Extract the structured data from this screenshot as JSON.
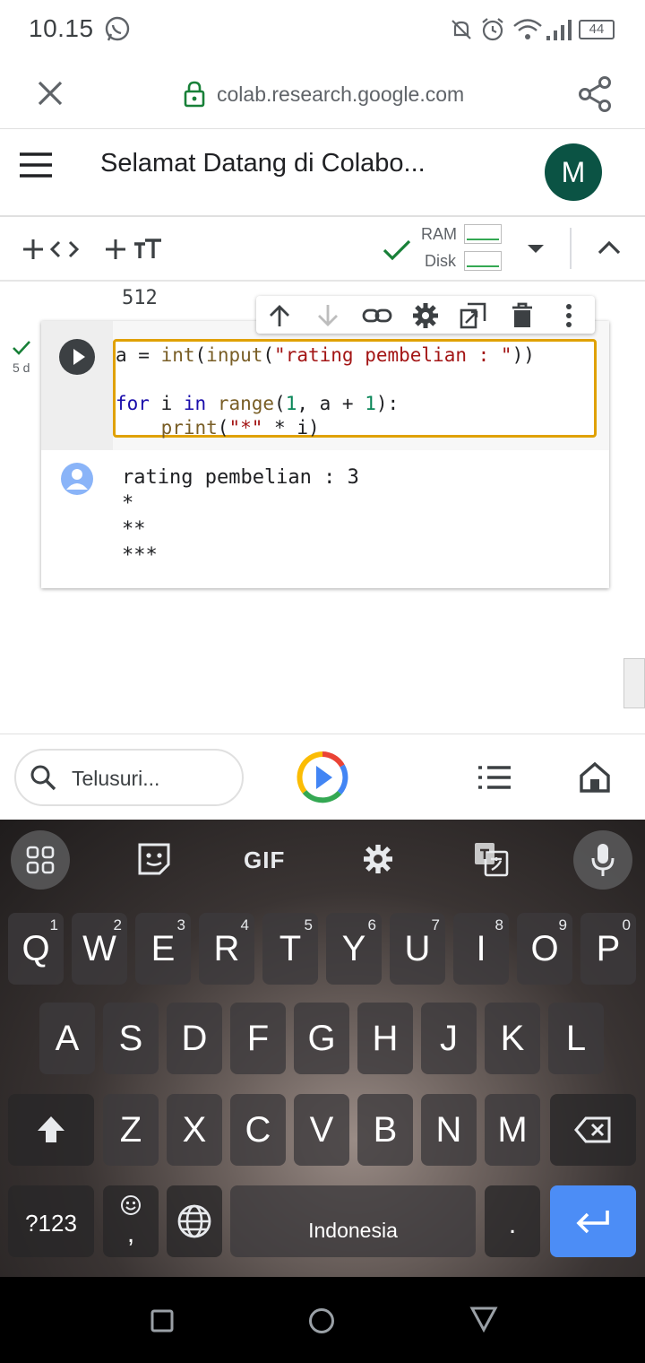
{
  "status_bar": {
    "time": "10.15",
    "battery": "44"
  },
  "browser": {
    "url": "colab.research.google.com"
  },
  "colab": {
    "title": "Selamat Datang di Colabo...",
    "avatar_letter": "M",
    "toolbar": {
      "ram_label": "RAM",
      "disk_label": "Disk"
    }
  },
  "notebook": {
    "prev_output": "512",
    "cell": {
      "status_time": "5 d",
      "code_lines": [
        "a = int(input(\"rating pembelian : \"))",
        "",
        "for i in range(1, a + 1):",
        "    print(\"*\" * i)"
      ],
      "output_lines": [
        "rating pembelian : 3",
        "*",
        "**",
        "***"
      ]
    }
  },
  "google_bar": {
    "search_placeholder": "Telusuri..."
  },
  "keyboard": {
    "toolbar": {
      "gif_label": "GIF"
    },
    "row1": [
      {
        "label": "Q",
        "hint": "1"
      },
      {
        "label": "W",
        "hint": "2"
      },
      {
        "label": "E",
        "hint": "3"
      },
      {
        "label": "R",
        "hint": "4"
      },
      {
        "label": "T",
        "hint": "5"
      },
      {
        "label": "Y",
        "hint": "6"
      },
      {
        "label": "U",
        "hint": "7"
      },
      {
        "label": "I",
        "hint": "8"
      },
      {
        "label": "O",
        "hint": "9"
      },
      {
        "label": "P",
        "hint": "0"
      }
    ],
    "row2": [
      "A",
      "S",
      "D",
      "F",
      "G",
      "H",
      "J",
      "K",
      "L"
    ],
    "row3": [
      "Z",
      "X",
      "C",
      "V",
      "B",
      "N",
      "M"
    ],
    "symbols_label": "?123",
    "comma_label": ",",
    "space_label": "Indonesia",
    "period_label": "."
  }
}
